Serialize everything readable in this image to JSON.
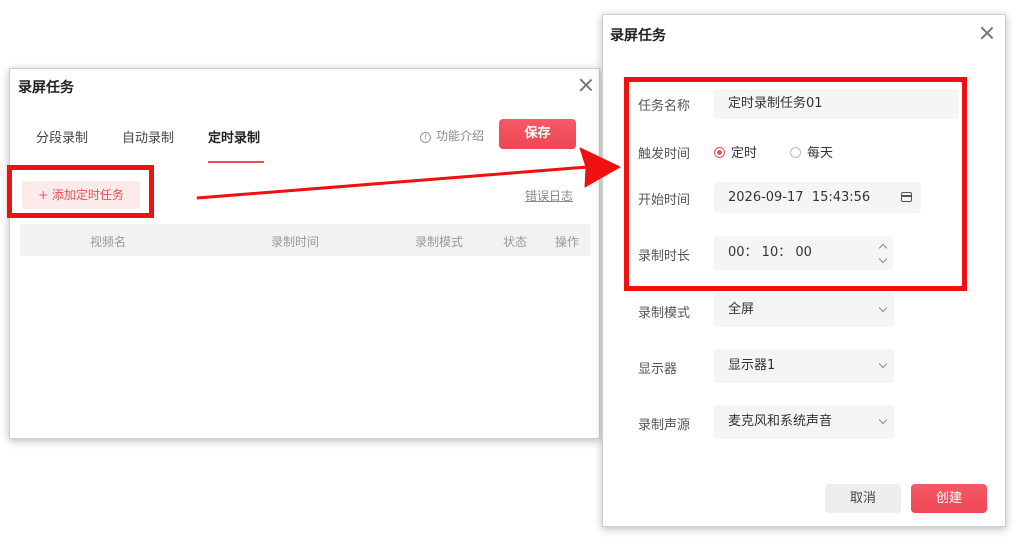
{
  "left_dialog": {
    "title": "录屏任务",
    "tabs": [
      {
        "label": "分段录制"
      },
      {
        "label": "自动录制"
      },
      {
        "label": "定时录制",
        "active": true
      }
    ],
    "help_label": "功能介绍",
    "save_label": "保存",
    "add_task_label": "+ 添加定时任务",
    "error_log_label": "错误日志",
    "table_headers": [
      "视频名",
      "录制时间",
      "录制模式",
      "状态",
      "操作"
    ]
  },
  "right_dialog": {
    "title": "录屏任务",
    "fields": {
      "task_name": {
        "label": "任务名称",
        "value": "定时录制任务01"
      },
      "trigger": {
        "label": "触发时间",
        "options": [
          "定时",
          "每天"
        ],
        "selected": "定时"
      },
      "start_time": {
        "label": "开始时间",
        "value": "2026-09-17  15:43:56"
      },
      "duration": {
        "label": "录制时长",
        "value": "00： 10： 00"
      },
      "mode": {
        "label": "录制模式",
        "value": "全屏"
      },
      "display": {
        "label": "显示器",
        "value": "显示器1"
      },
      "audio": {
        "label": "录制声源",
        "value": "麦克风和系统声音"
      }
    },
    "cancel_label": "取消",
    "create_label": "创建"
  },
  "colors": {
    "accent": "#f04b59",
    "annotation_red": "#f01010"
  },
  "icons": [
    "close-icon",
    "info-icon",
    "calendar-icon",
    "chevron-down-icon",
    "spinner-up-icon",
    "spinner-down-icon",
    "annotation-arrow"
  ]
}
